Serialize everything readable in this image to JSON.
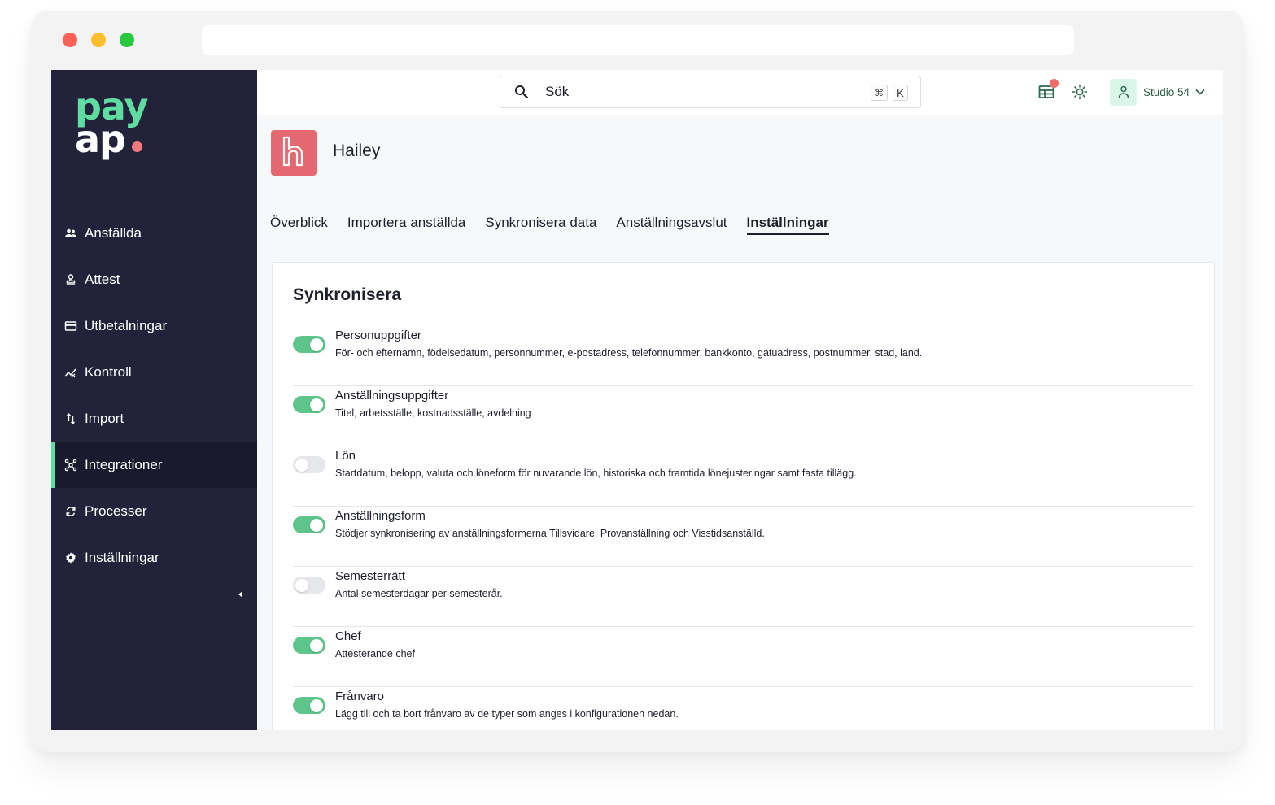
{
  "sidebar": {
    "logo_top": "pay",
    "logo_bottom": "ap",
    "items": [
      {
        "label": "Anställda",
        "icon": "people-icon"
      },
      {
        "label": "Attest",
        "icon": "stamp-icon"
      },
      {
        "label": "Utbetalningar",
        "icon": "card-icon"
      },
      {
        "label": "Kontroll",
        "icon": "chart-check-icon"
      },
      {
        "label": "Import",
        "icon": "import-arrows-icon"
      },
      {
        "label": "Integrationer",
        "icon": "integration-hub-icon",
        "active": true
      },
      {
        "label": "Processer",
        "icon": "refresh-icon"
      },
      {
        "label": "Inställningar",
        "icon": "gear-icon"
      }
    ]
  },
  "topbar": {
    "search_placeholder": "Sök",
    "shortcut_modifier": "⌘",
    "shortcut_key": "K",
    "user_name": "Studio 54"
  },
  "integration": {
    "name": "Hailey",
    "brand_color": "#e46870"
  },
  "tabs": [
    {
      "label": "Överblick"
    },
    {
      "label": "Importera anställda"
    },
    {
      "label": "Synkronisera data"
    },
    {
      "label": "Anställningsavslut"
    },
    {
      "label": "Inställningar",
      "active": true
    }
  ],
  "sync": {
    "title": "Synkronisera",
    "items": [
      {
        "title": "Personuppgifter",
        "desc": "För- och efternamn, födelsedatum, personnummer, e-postadress, telefonnummer, bankkonto, gatuadress, postnummer, stad, land.",
        "enabled": true
      },
      {
        "title": "Anställningsuppgifter",
        "desc": "Titel, arbetsställe, kostnadsställe, avdelning",
        "enabled": true
      },
      {
        "title": "Lön",
        "desc": "Startdatum, belopp, valuta och löneform för nuvarande lön, historiska och framtida lönejusteringar samt fasta tillägg.",
        "enabled": false
      },
      {
        "title": "Anställningsform",
        "desc": "Stödjer synkronisering av anställningsformerna Tillsvidare, Provanställning och Visstidsanställd.",
        "enabled": true
      },
      {
        "title": "Semesterrätt",
        "desc": "Antal semesterdagar per semesterår.",
        "enabled": false
      },
      {
        "title": "Chef",
        "desc": "Attesterande chef",
        "enabled": true
      },
      {
        "title": "Frånvaro",
        "desc": "Lägg till och ta bort frånvaro av de typer som anges i konfigurationen nedan.",
        "enabled": true
      }
    ]
  },
  "colors": {
    "sidebar_bg": "#22233a",
    "accent_green": "#5fdca0",
    "toggle_on": "#5ec58a",
    "notification": "#f26b6b"
  }
}
